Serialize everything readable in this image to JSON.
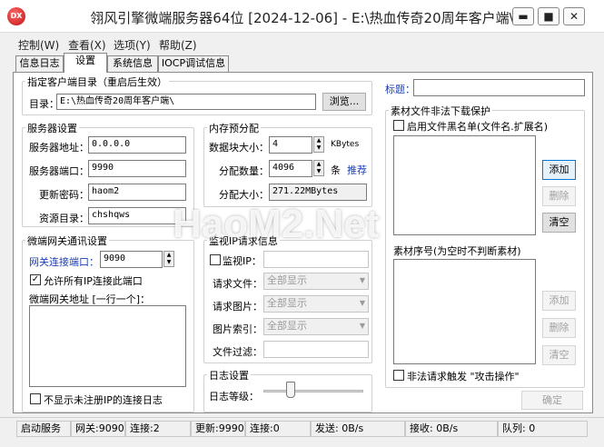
{
  "window": {
    "title": "翎风引擎微端服务器64位 [2024-12-06] - E:\\热血传奇20周年客户端\\",
    "app_icon_text": "DX",
    "minimize": "▬",
    "maximize": "■",
    "close": "✕"
  },
  "menu": [
    "控制(W)",
    "查看(X)",
    "选项(Y)",
    "帮助(Z)"
  ],
  "tabs": [
    "信息日志",
    "设置",
    "系统信息",
    "IOCP调试信息"
  ],
  "settings": {
    "client_dir_group": "指定客户端目录（重启后生效）",
    "dir_label": "目录：",
    "dir_value": "E:\\热血传奇20周年客户端\\",
    "browse_button": "浏览...",
    "server_group": "服务器设置",
    "server_addr_label": "服务器地址：",
    "server_addr_value": "0.0.0.0",
    "server_port_label": "服务器端口：",
    "server_port_value": "9990",
    "password_label": "更新密码：",
    "password_value": "haom2",
    "resource_label": "资源目录：",
    "resource_value": "chshqws",
    "memory_group": "内存预分配",
    "block_size_label": "数据块大小：",
    "block_size_value": "4",
    "block_size_unit": "KBytes",
    "alloc_count_label": "分配数量：",
    "alloc_count_value": "4096",
    "alloc_count_unit": "条",
    "recommend_link": "推荐",
    "alloc_size_label": "分配大小：",
    "alloc_size_value": "271.22MBytes",
    "gateway_group": "微端网关通讯设置",
    "gateway_port_label": "网关连接端口：",
    "gateway_port_value": "9090",
    "allow_all_ip_label": "允许所有IP连接此端口",
    "allow_all_ip_checked": true,
    "gateway_addr_label": "微端网关地址 [一行一个]：",
    "hide_unregistered_label": "不显示未注册IP的连接日志",
    "hide_unregistered_checked": false,
    "monitor_group": "监视IP请求信息",
    "monitor_ip_label": "监视IP：",
    "request_file_label": "请求文件：",
    "request_file_value": "全部显示",
    "request_image_label": "请求图片：",
    "request_image_value": "全部显示",
    "image_index_label": "图片索引：",
    "image_index_value": "全部显示",
    "file_filter_label": "文件过滤：",
    "log_group": "日志设置",
    "log_level_label": "日志等级：",
    "log_level": 0.25,
    "title_label": "标题：",
    "protect_group": "素材文件非法下载保护",
    "blacklist_label": "启用文件黑名单(文件名.扩展名)",
    "blacklist_checked": false,
    "add_button": "添加",
    "delete_button": "删除",
    "clear_button": "清空",
    "sequence_label": "素材序号(为空时不判断素材)",
    "add_button2": "添加",
    "delete_button2": "删除",
    "clear_button2": "清空",
    "attack_label": "非法请求触发 \"攻击操作\"",
    "attack_checked": false,
    "ok_button": "确定"
  },
  "status": {
    "start": "启动服务",
    "gateway": "网关:9090",
    "gateway_conn": "连接:2",
    "update": "更新:9990",
    "update_conn": "连接:0",
    "send": "发送: 0B/s",
    "recv": "接收: 0B/s",
    "queue": "队列: 0"
  },
  "watermark": "HaoM2.Net"
}
